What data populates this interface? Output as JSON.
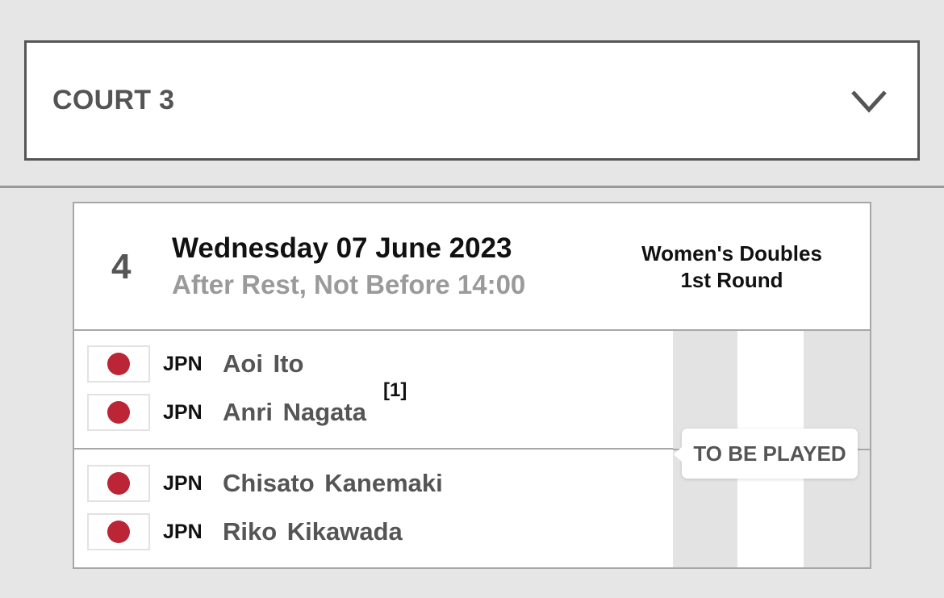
{
  "court_selector": {
    "label": "COURT 3",
    "icon": "chevron-down-icon"
  },
  "match": {
    "order": "4",
    "date": "Wednesday 07 June 2023",
    "time_note": "After Rest, Not Before 14:00",
    "event": "Women's Doubles",
    "round": "1st Round",
    "status": "TO BE PLAYED",
    "teams": [
      {
        "seed": "[1]",
        "players": [
          {
            "country": "JPN",
            "name": "Aoi Ito"
          },
          {
            "country": "JPN",
            "name": "Anri Nagata"
          }
        ]
      },
      {
        "seed": "",
        "players": [
          {
            "country": "JPN",
            "name": "Chisato Kanemaki"
          },
          {
            "country": "JPN",
            "name": "Riko Kikawada"
          }
        ]
      }
    ]
  },
  "colors": {
    "flag_red": "#bb2535",
    "text_gray": "#555555",
    "border": "#a7a7a7"
  }
}
